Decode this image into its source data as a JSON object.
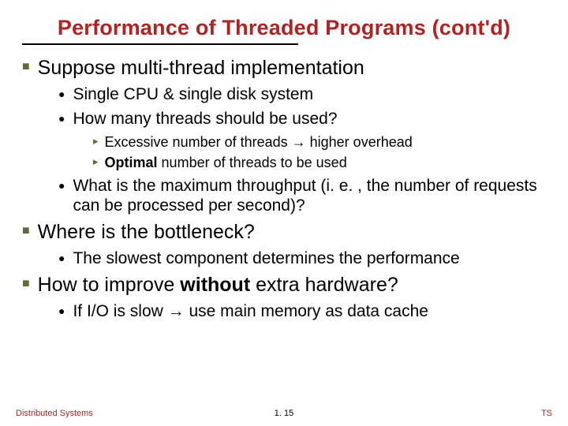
{
  "title": "Performance of Threaded Programs (cont'd)",
  "b1": {
    "a": "Suppose multi-thread implementation",
    "b": "Where is the bottleneck?",
    "c_pre": "How to improve ",
    "c_bold": "without",
    "c_post": " extra hardware?"
  },
  "b2": {
    "a1": "Single CPU & single disk system",
    "a2": "How many threads should be used?",
    "a3": "What is the maximum throughput (i. e. , the number of requests can be processed per second)?",
    "b1": "The slowest component determines the performance",
    "c1": "If I/O is slow → use main memory as data cache"
  },
  "b3": {
    "a2a": "Excessive number of threads → higher overhead",
    "a2b_bold": "Optimal",
    "a2b_post": " number of threads to be used"
  },
  "footer": {
    "left": "Distributed Systems",
    "center": "1. 15",
    "right": "TS"
  }
}
